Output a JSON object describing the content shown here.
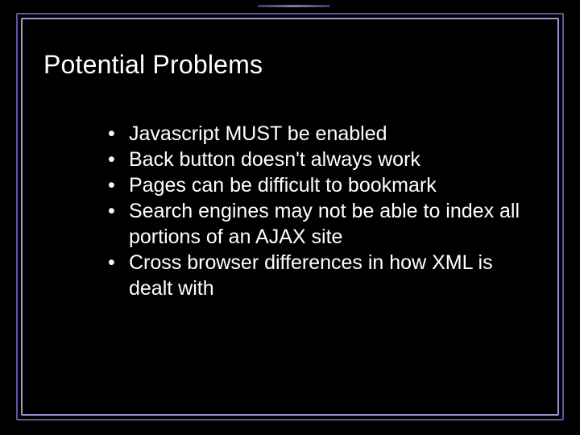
{
  "slide": {
    "title": "Potential Problems",
    "bullets": [
      "Javascript MUST be enabled",
      "Back button doesn't always work",
      "Pages can be difficult to bookmark",
      "Search engines may not be able to index all portions of an AJAX site",
      "Cross browser differences in how XML is dealt with"
    ]
  }
}
